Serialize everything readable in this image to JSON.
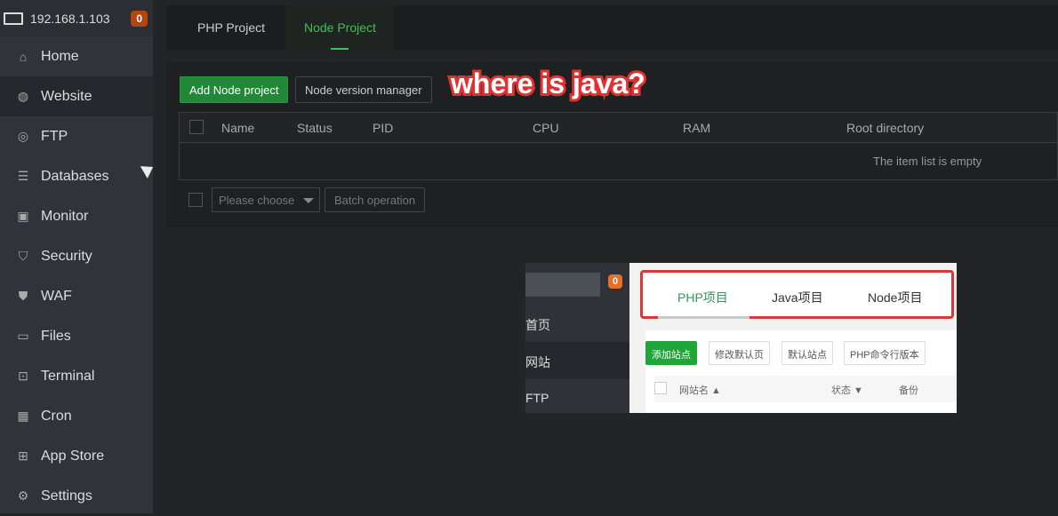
{
  "sidebar": {
    "host": "192.168.1.103",
    "badge": "0",
    "items": [
      {
        "label": "Home",
        "icon": "home-icon"
      },
      {
        "label": "Website",
        "icon": "globe-icon",
        "active": true
      },
      {
        "label": "FTP",
        "icon": "ftp-icon"
      },
      {
        "label": "Databases",
        "icon": "database-icon"
      },
      {
        "label": "Monitor",
        "icon": "monitor-icon"
      },
      {
        "label": "Security",
        "icon": "shield-icon"
      },
      {
        "label": "WAF",
        "icon": "waf-shield-icon"
      },
      {
        "label": "Files",
        "icon": "folder-icon"
      },
      {
        "label": "Terminal",
        "icon": "terminal-icon"
      },
      {
        "label": "Cron",
        "icon": "calendar-icon"
      },
      {
        "label": "App Store",
        "icon": "apps-icon"
      },
      {
        "label": "Settings",
        "icon": "gear-icon"
      }
    ]
  },
  "tabs": {
    "php": "PHP Project",
    "node": "Node Project",
    "active": "Node Project"
  },
  "toolbar": {
    "add": "Add Node project",
    "nvm": "Node version manager"
  },
  "table": {
    "columns": [
      "Name",
      "Status",
      "PID",
      "CPU",
      "RAM",
      "Root directory"
    ],
    "empty": "The item list is empty"
  },
  "footer": {
    "select_placeholder": "Please choose",
    "batch": "Batch operation"
  },
  "annotation": "where is java?",
  "inset": {
    "badge": "0",
    "side": [
      "首页",
      "网站",
      "FTP"
    ],
    "tabs": [
      "PHP项目",
      "Java项目",
      "Node项目"
    ],
    "buttons": [
      "添加站点",
      "修改默认页",
      "默认站点",
      "PHP命令行版本"
    ],
    "columns": [
      "网站名 ▲",
      "状态 ▼",
      "备份"
    ]
  },
  "colors": {
    "accent": "#3fbf5a",
    "badge": "#b5440f",
    "annotation": "#e03030"
  }
}
